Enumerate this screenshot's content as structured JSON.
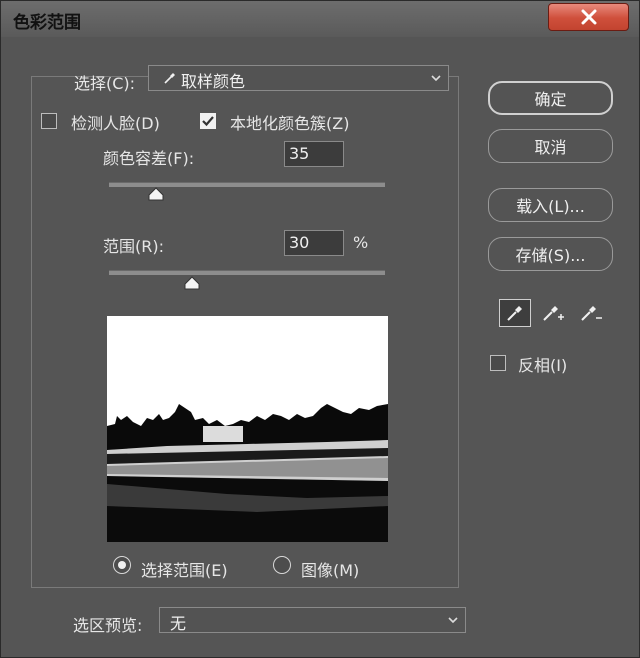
{
  "window": {
    "title": "色彩范围"
  },
  "select_field": {
    "label": "选择(C):",
    "value": "取样颜色"
  },
  "detect_faces": {
    "label": "检测人脸(D)",
    "checked": false
  },
  "localized_clusters": {
    "label": "本地化颜色簇(Z)",
    "checked": true
  },
  "fuzziness": {
    "label": "颜色容差(F):",
    "value": "35",
    "slider_fraction": 0.17
  },
  "range": {
    "label": "范围(R):",
    "value": "30",
    "unit": "%",
    "slider_fraction": 0.3
  },
  "view_options": {
    "selection_label": "选择范围(E)",
    "image_label": "图像(M)",
    "selected": "selection"
  },
  "selection_preview": {
    "label": "选区预览:",
    "value": "无"
  },
  "buttons": {
    "ok": "确定",
    "cancel": "取消",
    "load": "载入(L)...",
    "save": "存储(S)..."
  },
  "eyedroppers": [
    "eyedropper-icon",
    "eyedropper-plus-icon",
    "eyedropper-minus-icon"
  ],
  "invert": {
    "label": "反相(I)",
    "checked": false
  },
  "colors": {
    "dialog_bg": "#555555",
    "close_button": "#cf4f3b"
  }
}
